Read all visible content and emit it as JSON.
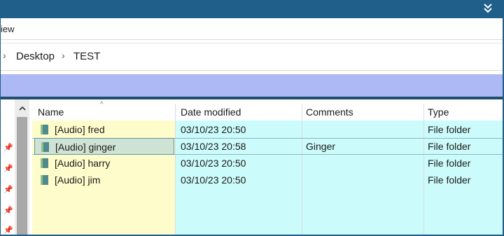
{
  "window": {
    "ribbon_tab": "iew",
    "expand_icon": "chevron-double-down-icon"
  },
  "breadcrumb": {
    "items": [
      "Desktop",
      "TEST"
    ],
    "separator_icon": "chevron-right-icon"
  },
  "colors": {
    "titlebar": "#1f5f8a",
    "band": "#adb9f5",
    "name_column": "#fffccc",
    "other_columns": "#ccfbfb"
  },
  "columns": [
    "Name",
    "Date modified",
    "Comments",
    "Type"
  ],
  "files": [
    {
      "name": "[Audio] fred",
      "date": "03/10/23 20:50",
      "comment": "",
      "type": "File folder",
      "selected": false
    },
    {
      "name": "[Audio] ginger",
      "date": "03/10/23 20:58",
      "comment": "Ginger",
      "type": "File folder",
      "selected": true
    },
    {
      "name": "[Audio] harry",
      "date": "03/10/23 20:50",
      "comment": "",
      "type": "File folder",
      "selected": false
    },
    {
      "name": "[Audio] jim",
      "date": "03/10/23 20:50",
      "comment": "",
      "type": "File folder",
      "selected": false
    }
  ]
}
